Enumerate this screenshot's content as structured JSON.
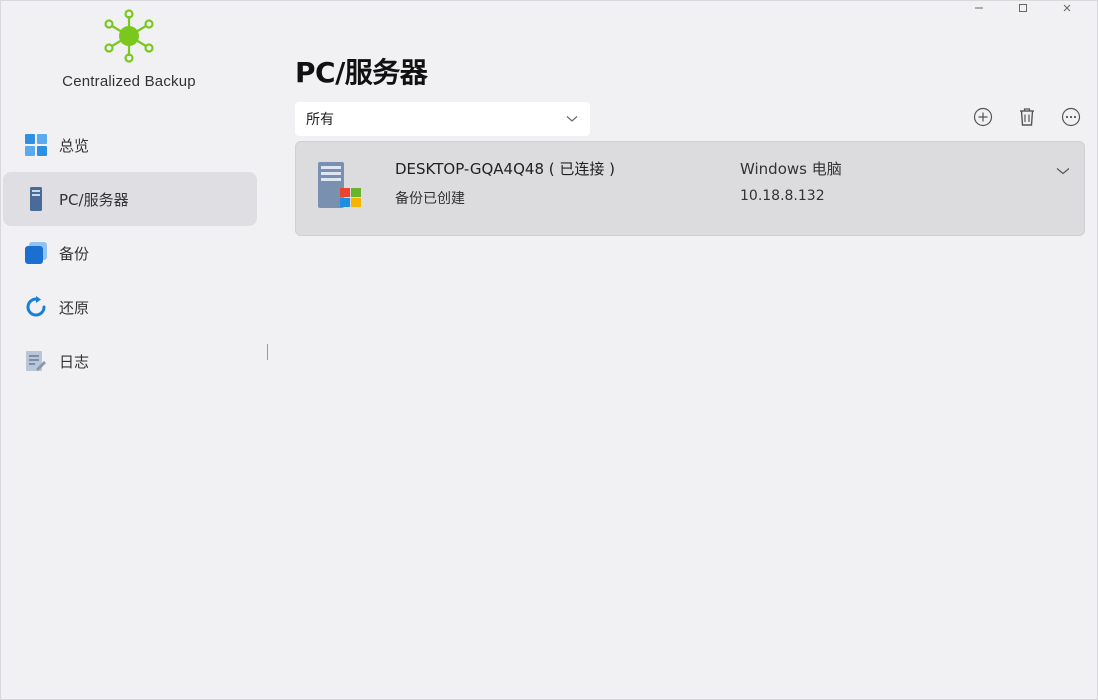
{
  "app": {
    "name": "Centralized Backup"
  },
  "window_controls": {
    "minimize": "—",
    "maximize": "▢",
    "close": "✕"
  },
  "sidebar": {
    "items": [
      {
        "label": "总览",
        "icon": "grid-icon",
        "active": false
      },
      {
        "label": "PC/服务器",
        "icon": "computer-tower-icon",
        "active": true
      },
      {
        "label": "备份",
        "icon": "backup-icon",
        "active": false
      },
      {
        "label": "还原",
        "icon": "restore-icon",
        "active": false
      },
      {
        "label": "日志",
        "icon": "log-icon",
        "active": false
      }
    ]
  },
  "main": {
    "title": "PC/服务器",
    "filter": {
      "selected": "所有"
    },
    "toolbar": {
      "add": "add-icon",
      "delete": "trash-icon",
      "more": "more-icon"
    },
    "devices": [
      {
        "name": "DESKTOP-GQA4Q48 ( 已连接 )",
        "status": "备份已创建",
        "type": "Windows 电脑",
        "ip": "10.18.8.132"
      }
    ]
  },
  "colors": {
    "accent": "#1a7fd9",
    "logo_green": "#7ac81e",
    "active_bg": "#dfdfe3",
    "card_bg": "#dcdcde"
  }
}
